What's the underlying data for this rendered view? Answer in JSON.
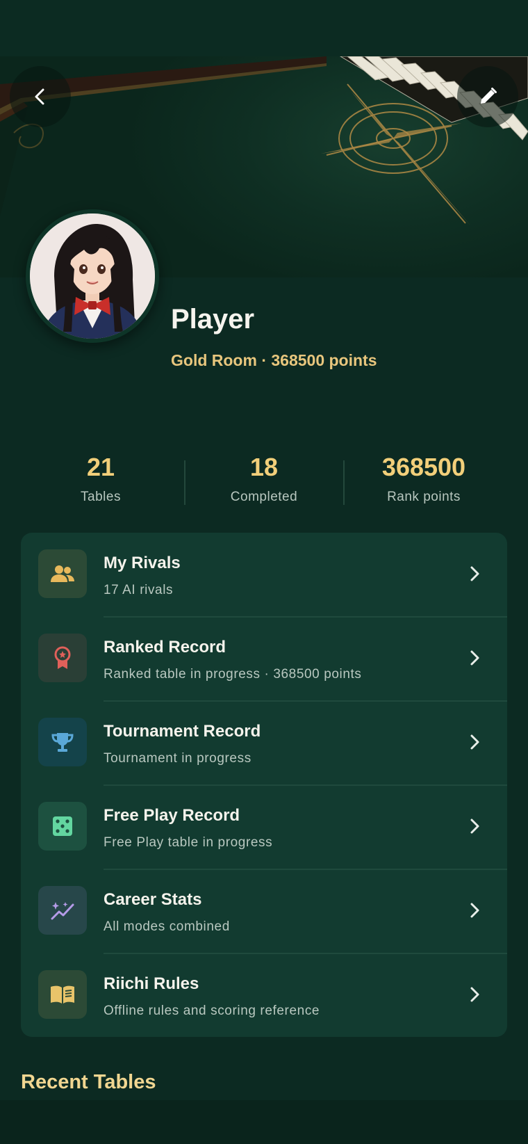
{
  "profile": {
    "name": "Player",
    "subtitle": "Gold Room · 368500 points"
  },
  "stats": [
    {
      "value": "21",
      "label": "Tables"
    },
    {
      "value": "18",
      "label": "Completed"
    },
    {
      "value": "368500",
      "label": "Rank points"
    }
  ],
  "menu": [
    {
      "title": "My Rivals",
      "subtitle": "17 AI rivals",
      "icon": "people-icon",
      "icon_color": "#e8b95c",
      "bg": "#2c4a36"
    },
    {
      "title": "Ranked Record",
      "subtitle": "Ranked table in progress · 368500 points",
      "icon": "award-icon",
      "icon_color": "#e0605a",
      "bg": "#2a3f36"
    },
    {
      "title": "Tournament Record",
      "subtitle": "Tournament in progress",
      "icon": "trophy-icon",
      "icon_color": "#5aa8d8",
      "bg": "#14434a"
    },
    {
      "title": "Free Play Record",
      "subtitle": "Free Play table in progress",
      "icon": "dice-icon",
      "icon_color": "#63d6a0",
      "bg": "#1d5140"
    },
    {
      "title": "Career Stats",
      "subtitle": "All modes combined",
      "icon": "sparkle-chart-icon",
      "icon_color": "#b59be8",
      "bg": "#27474a"
    },
    {
      "title": "Riichi Rules",
      "subtitle": "Offline rules and scoring reference",
      "icon": "book-icon",
      "icon_color": "#e9c46a",
      "bg": "#2c4a36"
    }
  ],
  "recent": {
    "title": "Recent Tables"
  },
  "colors": {
    "accent_gold": "#e8c67d",
    "card_bg": "#123b30",
    "page_bg": "#0c2a22"
  }
}
